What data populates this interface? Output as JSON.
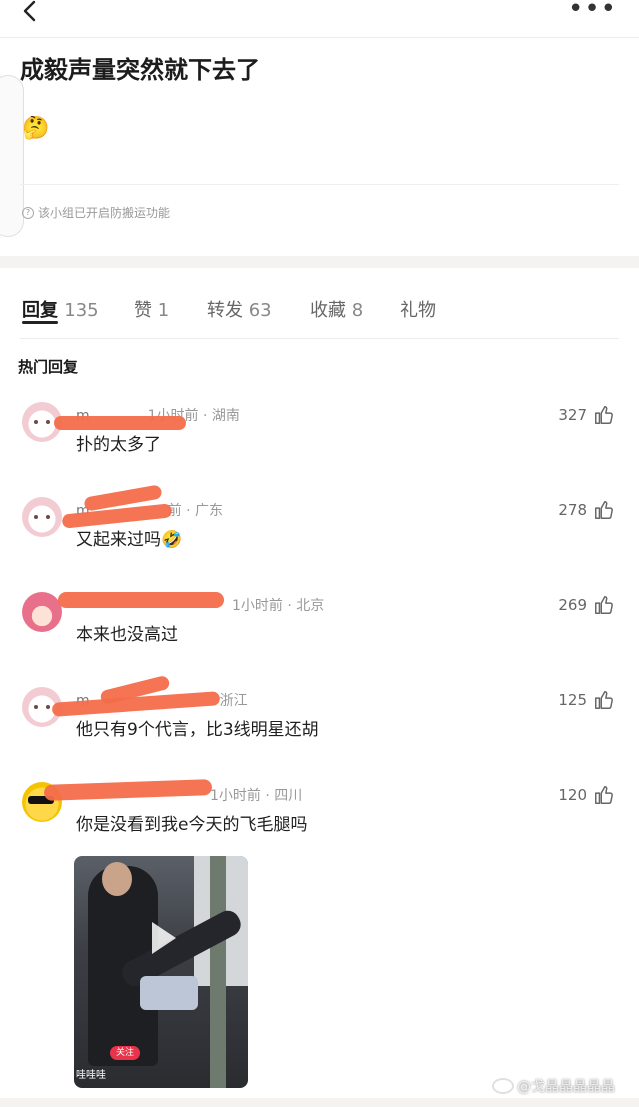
{
  "header": {
    "back_icon": "chevron-left-icon",
    "more_label": "•••"
  },
  "post": {
    "title": "成毅声量突然就下去了",
    "emoji": "🤔",
    "notice": "该小组已开启防搬运功能"
  },
  "tabs": [
    {
      "label": "回复",
      "count": "135"
    },
    {
      "label": "赞",
      "count": "1"
    },
    {
      "label": "转发",
      "count": "63"
    },
    {
      "label": "收藏",
      "count": "8"
    },
    {
      "label": "礼物",
      "count": ""
    }
  ],
  "hot_label": "热门回复",
  "comments": [
    {
      "user": "m",
      "time": "1小时前",
      "location": "湖南",
      "text": "扑的太多了",
      "likes": "327"
    },
    {
      "user": "m",
      "time": "前",
      "location": "广东",
      "text": "又起来过吗🤣",
      "likes": "278"
    },
    {
      "user": "",
      "time": "1小时前",
      "location": "北京",
      "text": "本来也没高过",
      "likes": "269"
    },
    {
      "user": "m",
      "time": "",
      "location": "浙江",
      "text": "他只有9个代言，比3线明星还胡",
      "likes": "125"
    },
    {
      "user": "",
      "time": "1小时前",
      "location": "四川",
      "text": "你是没看到我e今天的飞毛腿吗",
      "likes": "120"
    }
  ],
  "video": {
    "follow_label": "关注",
    "user_label": "哇哇哇"
  },
  "watermark": "@戈晶晶晶晶晶"
}
